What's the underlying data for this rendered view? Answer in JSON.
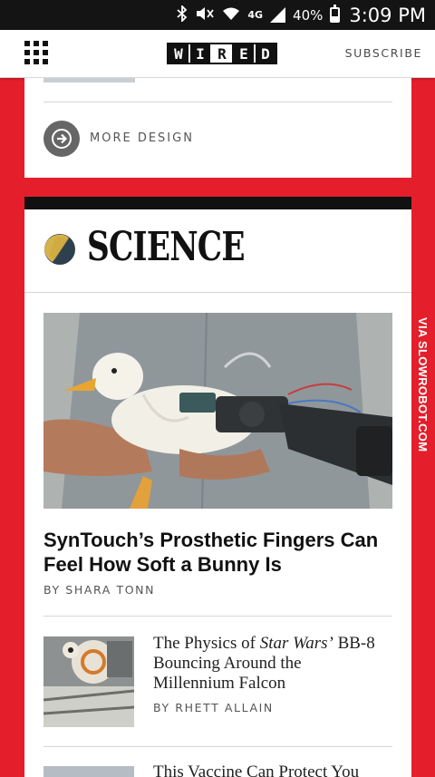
{
  "status_bar": {
    "battery": "40%",
    "time": "3:09 PM",
    "network": "4G"
  },
  "header": {
    "logo_letters": [
      "W",
      "I",
      "R",
      "E",
      "D"
    ],
    "subscribe": "SUBSCRIBE"
  },
  "design_section": {
    "more_label": "MORE DESIGN"
  },
  "science_section": {
    "title": "SCIENCE",
    "lead_story": {
      "headline": "SynTouch’s Prosthetic Fingers Can Feel How Soft a Bunny Is",
      "byline": "BY SHARA TONN"
    },
    "story_2": {
      "headline_pre": "The Physics of ",
      "headline_em": "Star Wars’",
      "headline_post": " BB-8 Bouncing Around the Millennium Falcon",
      "byline": "BY RHETT ALLAIN"
    },
    "story_3": {
      "headline": "This Vaccine Can Protect You"
    }
  },
  "watermark": "VIA SLOWROBOT.COM",
  "colors": {
    "page_background": "#e41e2b",
    "status_bar": "#141414",
    "card": "#ffffff",
    "section_bar": "#111111"
  }
}
